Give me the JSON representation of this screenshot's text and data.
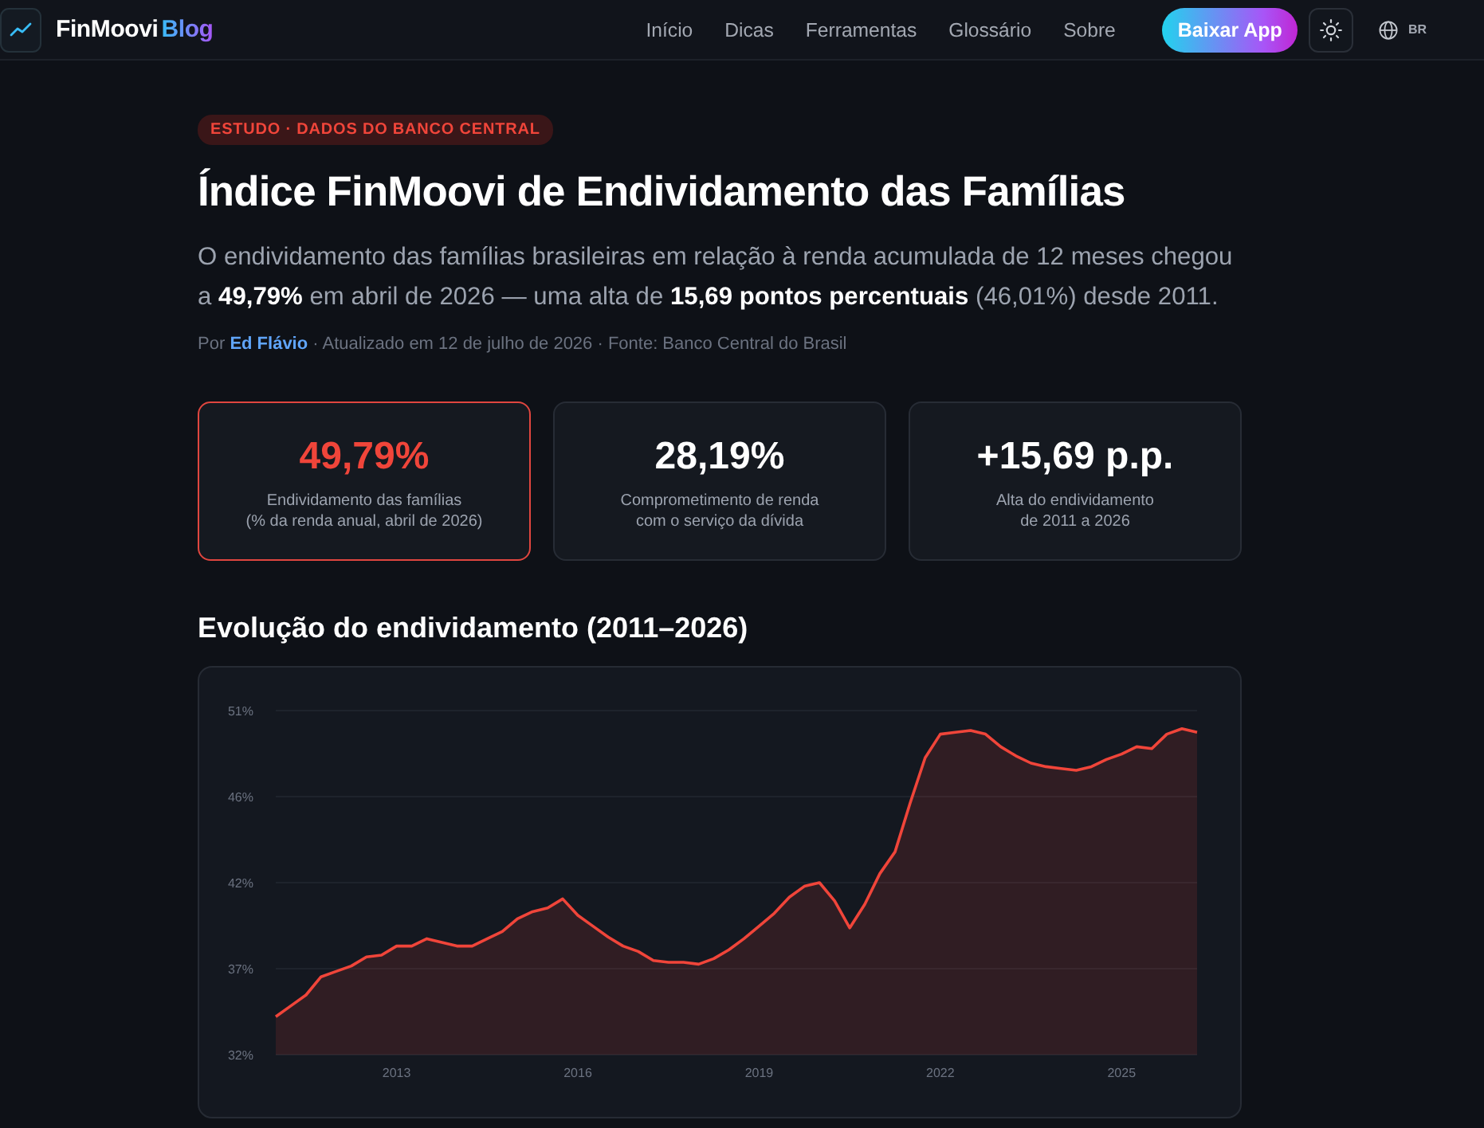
{
  "header": {
    "logo": {
      "name": "FinMoovi",
      "suffix": "Blog"
    },
    "nav": [
      {
        "label": "Início"
      },
      {
        "label": "Dicas"
      },
      {
        "label": "Ferramentas"
      },
      {
        "label": "Glossário"
      },
      {
        "label": "Sobre"
      }
    ],
    "cta": "Baixar App",
    "language": "BR"
  },
  "article": {
    "tag": "ESTUDO · DADOS DO BANCO CENTRAL",
    "title": "Índice FinMoovi de Endividamento das Famílias",
    "lead": "O endividamento das famílias brasileiras em relação à renda acumulada de 12 meses chegou a **49,79%** em abril de 2026 — uma alta de **15,69 pontos percentuais** (46,01%) desde 2011.",
    "byline": {
      "prefix": "Por",
      "author": "Ed Flávio",
      "details": "· Atualizado em 12 de julho de 2026 · Fonte: Banco Central do Brasil"
    }
  },
  "stats": [
    {
      "value": "49,79%",
      "label_lines": [
        "Endividamento das famílias",
        "(% da renda anual, abril de 2026)"
      ],
      "highlighted": true
    },
    {
      "value": "28,19%",
      "label_lines": [
        "Comprometimento de renda",
        "com o serviço da dívida"
      ],
      "highlighted": false
    },
    {
      "value": "+15,69 p.p.",
      "label_lines": [
        "Alta do endividamento",
        "de 2011 a 2026"
      ],
      "highlighted": false
    }
  ],
  "chart_section": {
    "heading": "Evolução do endividamento (2011–2026)",
    "chart_data": {
      "type": "area",
      "grid": true,
      "x": [
        2011,
        2011.25,
        2011.5,
        2011.75,
        2012,
        2012.25,
        2012.5,
        2012.75,
        2013,
        2013.25,
        2013.5,
        2013.75,
        2014,
        2014.25,
        2014.5,
        2014.75,
        2015,
        2015.25,
        2015.5,
        2015.75,
        2016,
        2016.25,
        2016.5,
        2016.75,
        2017,
        2017.25,
        2017.5,
        2017.75,
        2018,
        2018.25,
        2018.5,
        2018.75,
        2019,
        2019.25,
        2019.5,
        2019.75,
        2020,
        2020.25,
        2020.5,
        2020.75,
        2021,
        2021.25,
        2021.5,
        2021.75,
        2022,
        2022.25,
        2022.5,
        2022.75,
        2023,
        2023.25,
        2023.5,
        2023.75,
        2024,
        2024.25,
        2024.5,
        2024.75,
        2025,
        2025.25,
        2025.5,
        2025.75,
        2026,
        2026.25
      ],
      "series": [
        {
          "color": "#f0453a",
          "values": [
            34.1,
            34.7,
            35.3,
            36.3,
            36.6,
            36.9,
            37.4,
            37.5,
            38.0,
            38.0,
            38.4,
            38.2,
            38.0,
            38.0,
            38.4,
            38.8,
            39.5,
            39.9,
            40.1,
            40.6,
            39.7,
            39.1,
            38.5,
            38.0,
            37.7,
            37.2,
            37.1,
            37.1,
            37.0,
            37.3,
            37.8,
            38.4,
            39.1,
            39.8,
            40.7,
            41.3,
            41.5,
            40.5,
            39.0,
            40.3,
            42.0,
            43.2,
            45.9,
            48.4,
            49.7,
            49.8,
            49.9,
            49.7,
            49.0,
            48.5,
            48.1,
            47.9,
            47.8,
            47.7,
            47.9,
            48.3,
            48.6,
            49.0,
            48.9,
            49.7,
            50.0,
            49.8
          ]
        }
      ],
      "xlim": [
        2011,
        2026.25
      ],
      "ylim": [
        32,
        51
      ],
      "xticks": [
        2013,
        2016,
        2019,
        2022,
        2025
      ],
      "yticks": [
        {
          "value": 32,
          "label": "32%"
        },
        {
          "value": 36.75,
          "label": "37%"
        },
        {
          "value": 41.5,
          "label": "42%"
        },
        {
          "value": 46.25,
          "label": "46%"
        },
        {
          "value": 51,
          "label": "51%"
        }
      ]
    }
  }
}
